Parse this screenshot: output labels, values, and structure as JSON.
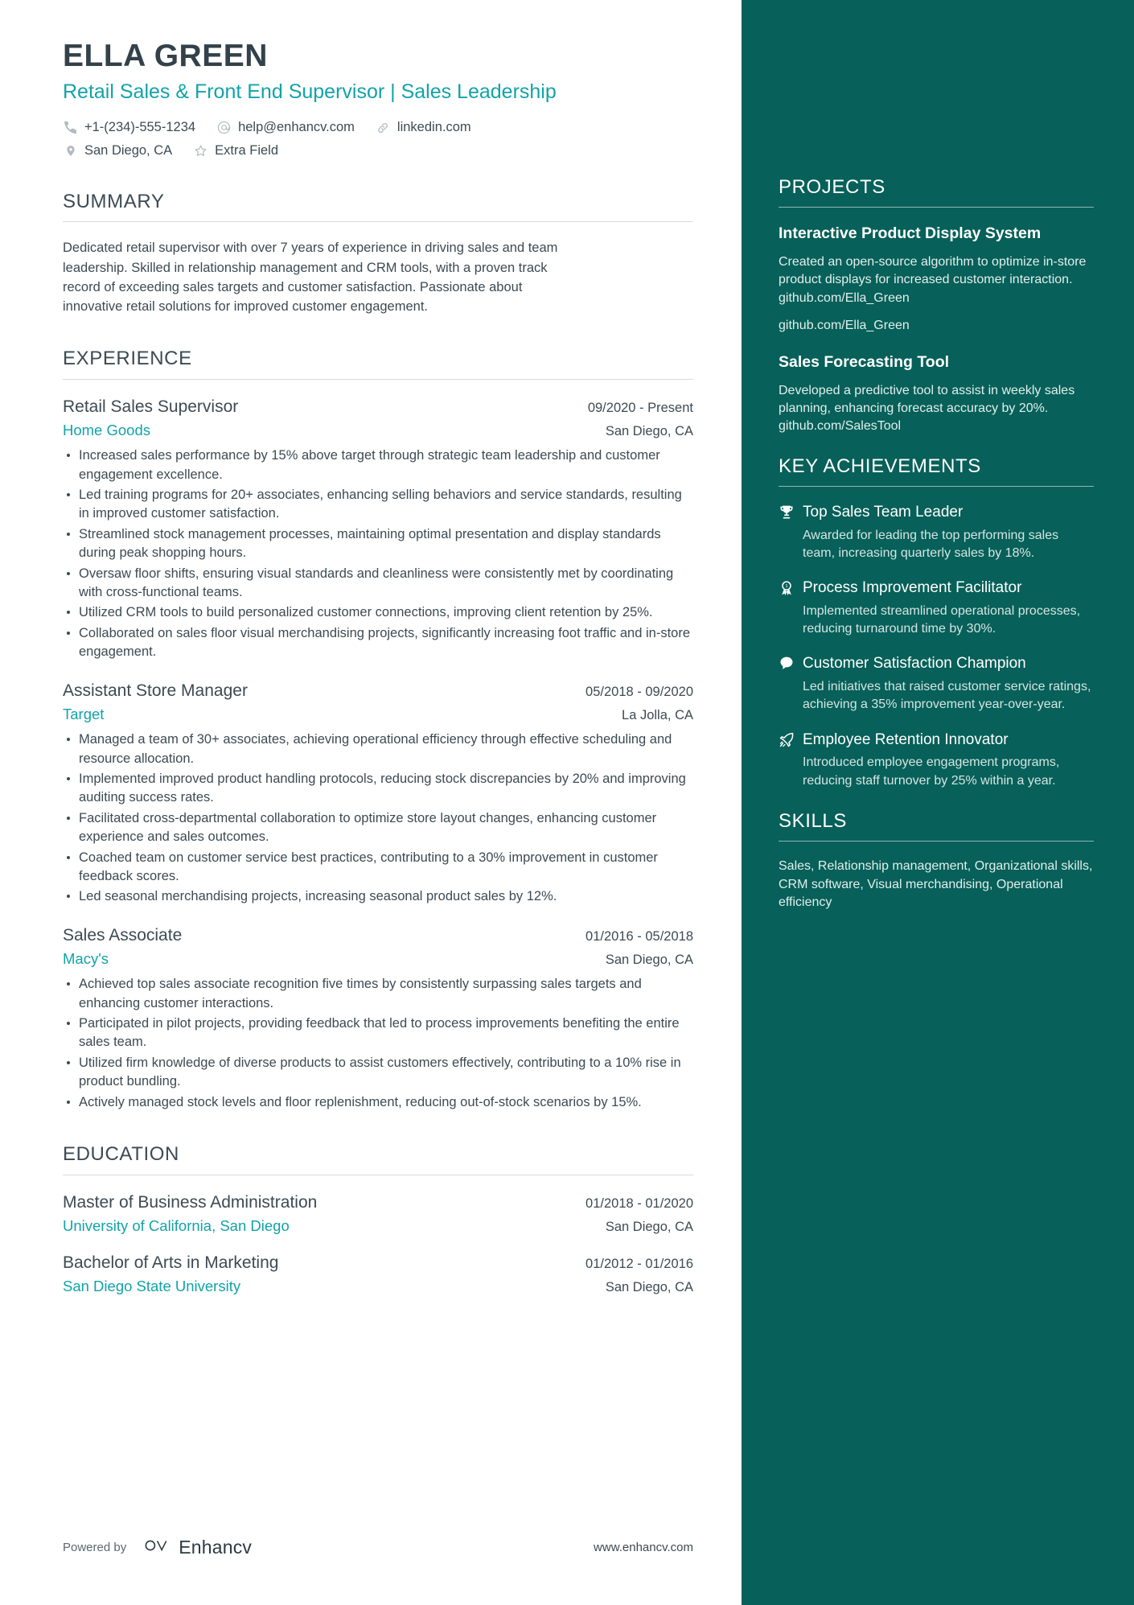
{
  "colors": {
    "accent_teal": "#12a3a8",
    "sidebar_bg": "#076059",
    "heading": "#3d4a53",
    "body": "#3d4a53"
  },
  "header": {
    "name": "ELLA GREEN",
    "headline": "Retail Sales & Front End Supervisor | Sales Leadership",
    "contacts_row1": [
      {
        "icon": "phone-icon",
        "text": "+1-(234)-555-1234"
      },
      {
        "icon": "email-icon",
        "text": "help@enhancv.com"
      },
      {
        "icon": "link-icon",
        "text": "linkedin.com"
      }
    ],
    "contacts_row2": [
      {
        "icon": "location-pin-icon",
        "text": "San Diego, CA"
      },
      {
        "icon": "star-icon",
        "text": "Extra Field"
      }
    ]
  },
  "summary": {
    "title": "SUMMARY",
    "text": "Dedicated retail supervisor with over 7 years of experience in driving sales and team leadership. Skilled in relationship management and CRM tools, with a proven track record of exceeding sales targets and customer satisfaction. Passionate about innovative retail solutions for improved customer engagement."
  },
  "experience": {
    "title": "EXPERIENCE",
    "entries": [
      {
        "role": "Retail Sales Supervisor",
        "dates": "09/2020 - Present",
        "company": "Home Goods",
        "location": "San Diego, CA",
        "bullets": [
          "Increased sales performance by 15% above target through strategic team leadership and customer engagement excellence.",
          "Led training programs for 20+ associates, enhancing selling behaviors and service standards, resulting in improved customer satisfaction.",
          "Streamlined stock management processes, maintaining optimal presentation and display standards during peak shopping hours.",
          "Oversaw floor shifts, ensuring visual standards and cleanliness were consistently met by coordinating with cross-functional teams.",
          "Utilized CRM tools to build personalized customer connections, improving client retention by 25%.",
          "Collaborated on sales floor visual merchandising projects, significantly increasing foot traffic and in-store engagement."
        ]
      },
      {
        "role": "Assistant Store Manager",
        "dates": "05/2018 - 09/2020",
        "company": "Target",
        "location": "La Jolla, CA",
        "bullets": [
          "Managed a team of 30+ associates, achieving operational efficiency through effective scheduling and resource allocation.",
          "Implemented improved product handling protocols, reducing stock discrepancies by 20% and improving auditing success rates.",
          "Facilitated cross-departmental collaboration to optimize store layout changes, enhancing customer experience and sales outcomes.",
          "Coached team on customer service best practices, contributing to a 30% improvement in customer feedback scores.",
          "Led seasonal merchandising projects, increasing seasonal product sales by 12%."
        ]
      },
      {
        "role": "Sales Associate",
        "dates": "01/2016 - 05/2018",
        "company": "Macy's",
        "location": "San Diego, CA",
        "bullets": [
          "Achieved top sales associate recognition five times by consistently surpassing sales targets and enhancing customer interactions.",
          "Participated in pilot projects, providing feedback that led to process improvements benefiting the entire sales team.",
          "Utilized firm knowledge of diverse products to assist customers effectively, contributing to a 10% rise in product bundling.",
          "Actively managed stock levels and floor replenishment, reducing out-of-stock scenarios by 15%."
        ]
      }
    ]
  },
  "education": {
    "title": "EDUCATION",
    "entries": [
      {
        "degree": "Master of Business Administration",
        "dates": "01/2018 - 01/2020",
        "school": "University of California, San Diego",
        "location": "San Diego, CA"
      },
      {
        "degree": "Bachelor of Arts in Marketing",
        "dates": "01/2012 - 01/2016",
        "school": "San Diego State University",
        "location": "San Diego, CA"
      }
    ]
  },
  "footer": {
    "powered_by": "Powered by",
    "brand": "Enhancv",
    "url": "www.enhancv.com"
  },
  "sidebar": {
    "projects": {
      "title": "PROJECTS",
      "items": [
        {
          "name": "Interactive Product Display System",
          "description": "Created an open-source algorithm to optimize in-store product displays for increased customer interaction. github.com/Ella_Green",
          "link": "github.com/Ella_Green"
        },
        {
          "name": "Sales Forecasting Tool",
          "description": "Developed a predictive tool to assist in weekly sales planning, enhancing forecast accuracy by 20%. github.com/SalesTool",
          "link": ""
        }
      ]
    },
    "achievements": {
      "title": "KEY ACHIEVEMENTS",
      "items": [
        {
          "icon": "trophy-icon",
          "title": "Top Sales Team Leader",
          "description": "Awarded for leading the top performing sales team, increasing quarterly sales by 18%."
        },
        {
          "icon": "award-ribbon-icon",
          "title": "Process Improvement Facilitator",
          "description": "Implemented streamlined operational processes, reducing turnaround time by 30%."
        },
        {
          "icon": "speech-bubble-icon",
          "title": "Customer Satisfaction Champion",
          "description": "Led initiatives that raised customer service ratings, achieving a 35% improvement year-over-year."
        },
        {
          "icon": "rocket-icon",
          "title": "Employee Retention Innovator",
          "description": "Introduced employee engagement programs, reducing staff turnover by 25% within a year."
        }
      ]
    },
    "skills": {
      "title": "SKILLS",
      "text": "Sales, Relationship management, Organizational skills, CRM software, Visual merchandising, Operational efficiency"
    }
  }
}
